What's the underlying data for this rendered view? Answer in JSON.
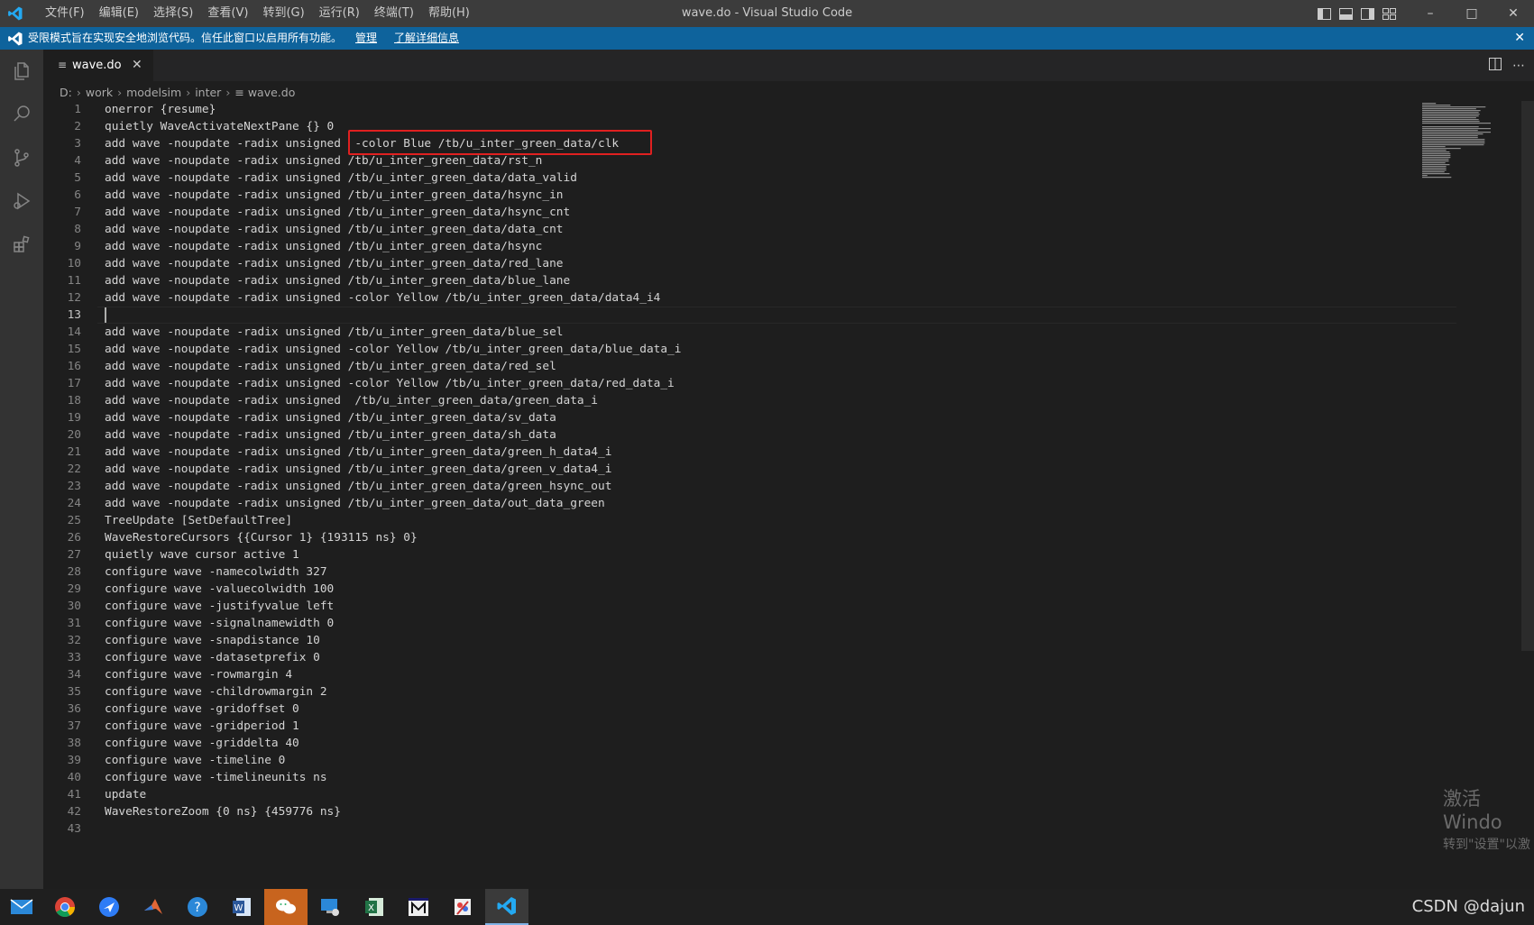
{
  "titlebar": {
    "title": "wave.do - Visual Studio Code",
    "menu": [
      "文件(F)",
      "编辑(E)",
      "选择(S)",
      "查看(V)",
      "转到(G)",
      "运行(R)",
      "终端(T)",
      "帮助(H)"
    ]
  },
  "banner": {
    "message": "受限模式旨在实现安全地浏览代码。信任此窗口以启用所有功能。",
    "manage": "管理",
    "learn_more": "了解详细信息"
  },
  "tab": {
    "label": "wave.do"
  },
  "breadcrumb": [
    "D:",
    "work",
    "modelsim",
    "inter",
    "wave.do"
  ],
  "editor": {
    "active_line": 13,
    "lines": [
      "onerror {resume}",
      "quietly WaveActivateNextPane {} 0",
      "add wave -noupdate -radix unsigned  -color Blue /tb/u_inter_green_data/clk",
      "add wave -noupdate -radix unsigned /tb/u_inter_green_data/rst_n",
      "add wave -noupdate -radix unsigned /tb/u_inter_green_data/data_valid",
      "add wave -noupdate -radix unsigned /tb/u_inter_green_data/hsync_in",
      "add wave -noupdate -radix unsigned /tb/u_inter_green_data/hsync_cnt",
      "add wave -noupdate -radix unsigned /tb/u_inter_green_data/data_cnt",
      "add wave -noupdate -radix unsigned /tb/u_inter_green_data/hsync",
      "add wave -noupdate -radix unsigned /tb/u_inter_green_data/red_lane",
      "add wave -noupdate -radix unsigned /tb/u_inter_green_data/blue_lane",
      "add wave -noupdate -radix unsigned -color Yellow /tb/u_inter_green_data/data4_i4",
      "",
      "add wave -noupdate -radix unsigned /tb/u_inter_green_data/blue_sel",
      "add wave -noupdate -radix unsigned -color Yellow /tb/u_inter_green_data/blue_data_i",
      "add wave -noupdate -radix unsigned /tb/u_inter_green_data/red_sel",
      "add wave -noupdate -radix unsigned -color Yellow /tb/u_inter_green_data/red_data_i",
      "add wave -noupdate -radix unsigned  /tb/u_inter_green_data/green_data_i",
      "add wave -noupdate -radix unsigned /tb/u_inter_green_data/sv_data",
      "add wave -noupdate -radix unsigned /tb/u_inter_green_data/sh_data",
      "add wave -noupdate -radix unsigned /tb/u_inter_green_data/green_h_data4_i",
      "add wave -noupdate -radix unsigned /tb/u_inter_green_data/green_v_data4_i",
      "add wave -noupdate -radix unsigned /tb/u_inter_green_data/green_hsync_out",
      "add wave -noupdate -radix unsigned /tb/u_inter_green_data/out_data_green",
      "TreeUpdate [SetDefaultTree]",
      "WaveRestoreCursors {{Cursor 1} {193115 ns} 0}",
      "quietly wave cursor active 1",
      "configure wave -namecolwidth 327",
      "configure wave -valuecolwidth 100",
      "configure wave -justifyvalue left",
      "configure wave -signalnamewidth 0",
      "configure wave -snapdistance 10",
      "configure wave -datasetprefix 0",
      "configure wave -rowmargin 4",
      "configure wave -childrowmargin 2",
      "configure wave -gridoffset 0",
      "configure wave -gridperiod 1",
      "configure wave -griddelta 40",
      "configure wave -timeline 0",
      "configure wave -timelineunits ns",
      "update",
      "WaveRestoreZoom {0 ns} {459776 ns}",
      ""
    ]
  },
  "watermark": {
    "line1": "激活 Windo",
    "line2": "转到\"设置\"以激"
  },
  "taskbar": {
    "apps": [
      "mail-icon",
      "chrome-icon",
      "feishu-icon",
      "matlab-icon",
      "help-icon",
      "word-icon",
      "wechat-icon",
      "remote-icon",
      "excel-icon",
      "modelsim-icon",
      "paint-icon",
      "vscode-icon"
    ],
    "csdn_text": "CSDN @dajun"
  },
  "colors": {
    "banner": "#0e639c",
    "highlight_box": "#e02020",
    "titlebar": "#3c3c3c",
    "activity_bar": "#333333"
  }
}
